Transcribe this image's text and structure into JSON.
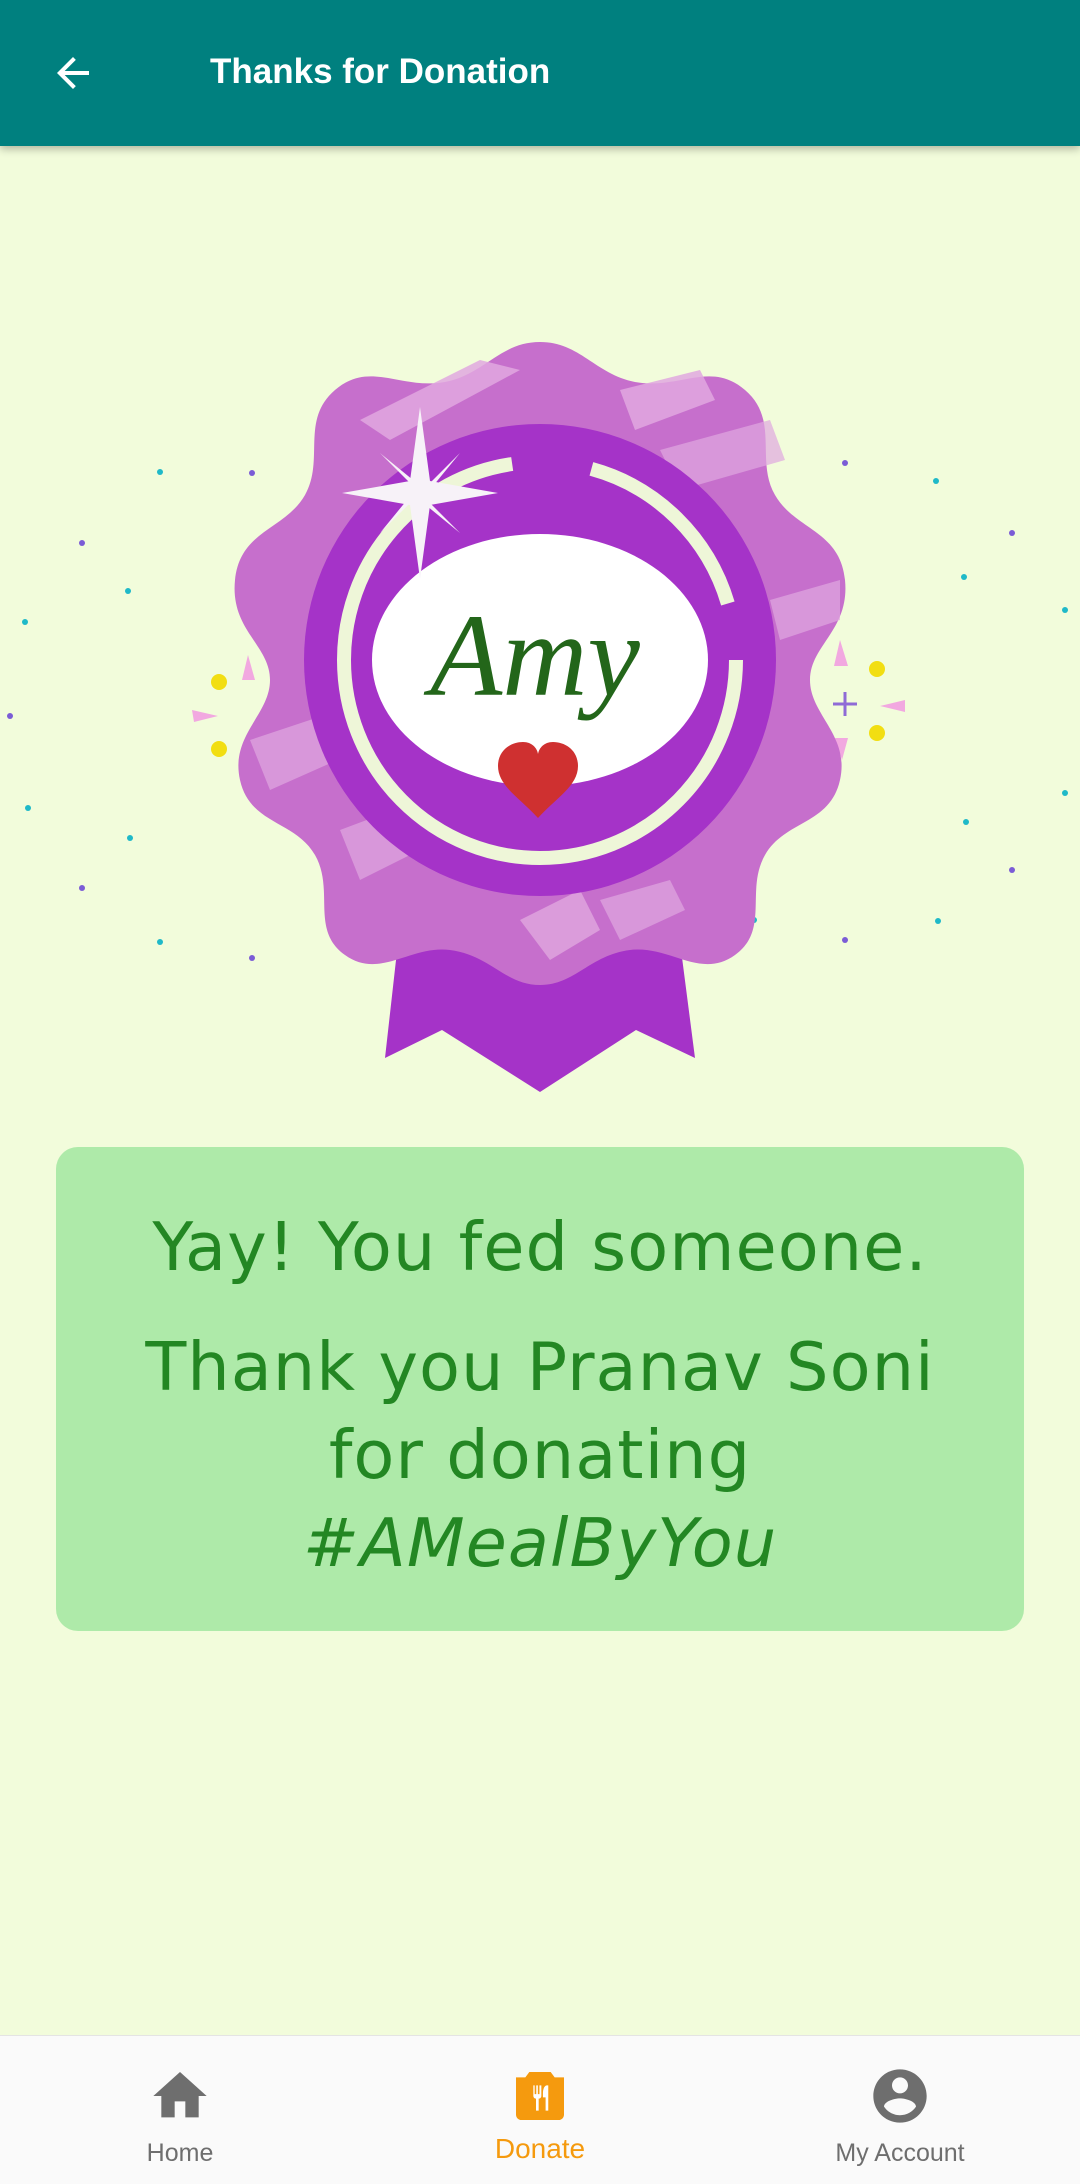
{
  "app_bar": {
    "title": "Thanks for Donation",
    "back_icon": "arrow-back-icon"
  },
  "badge": {
    "name": "Amy",
    "icon": "heart-icon"
  },
  "message": {
    "line1": "Yay! You fed someone.",
    "line2": "Thank you Pranav Soni for donating",
    "hashtag": "#AMealByYou"
  },
  "bottom_nav": {
    "items": [
      {
        "label": "Home",
        "icon": "home-icon"
      },
      {
        "label": "Donate",
        "icon": "donate-icon",
        "active": true
      },
      {
        "label": "My Account",
        "icon": "account-circle-icon"
      }
    ]
  },
  "colors": {
    "app_bar": "#00807f",
    "background": "#f2fcdb",
    "card": "#aeeaa9",
    "card_text": "#238723",
    "nav_active": "#f59a0e",
    "nav_inactive": "#6e6e6e"
  }
}
